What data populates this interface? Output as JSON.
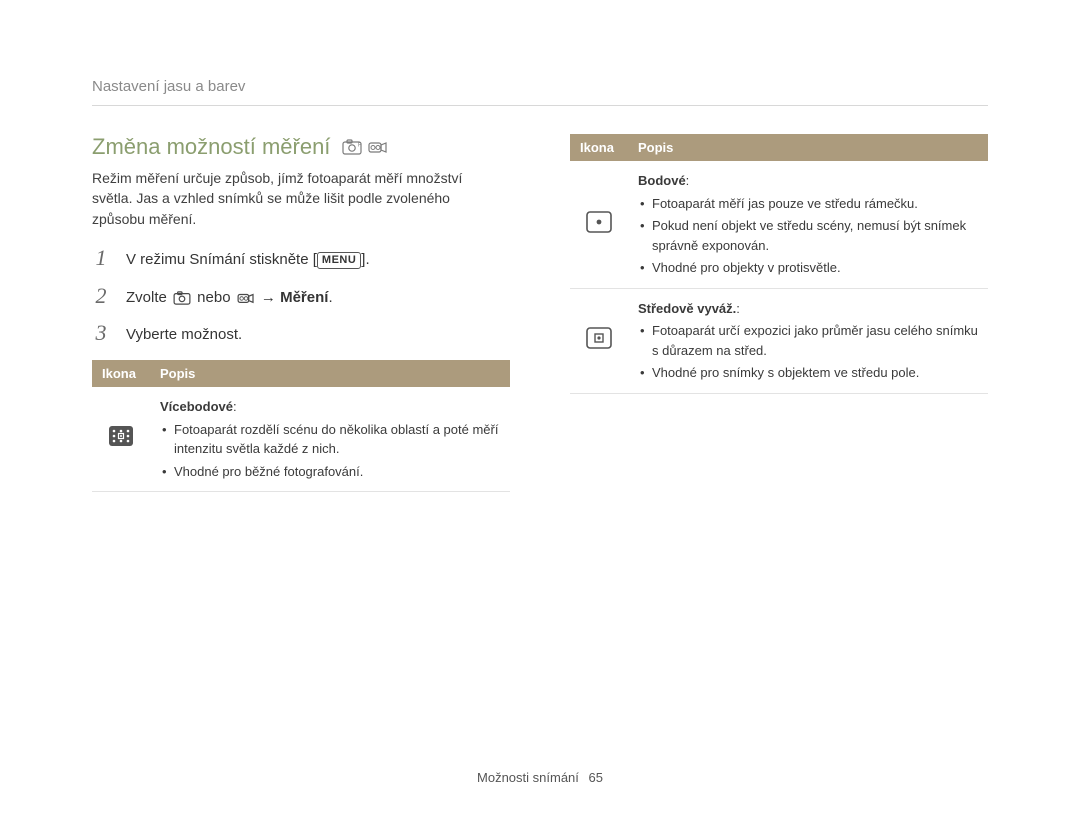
{
  "breadcrumb": "Nastavení jasu a barev",
  "heading": "Změna možností měření",
  "intro": "Režim měření určuje způsob, jímž fotoaparát měří množství světla. Jas a vzhled snímků se může lišit podle zvoleného způsobu měření.",
  "steps": {
    "n1": "1",
    "t1_a": "V režimu Snímání stiskněte [",
    "t1_menu": "MENU",
    "t1_b": "].",
    "n2": "2",
    "t2_a": "Zvolte ",
    "t2_b": " nebo ",
    "t2_c": " → ",
    "t2_bold": "Měření",
    "t2_d": ".",
    "n3": "3",
    "t3": "Vyberte možnost."
  },
  "table": {
    "hdr_icon": "Ikona",
    "hdr_desc": "Popis",
    "rows": [
      {
        "icon": "multi",
        "title": "Vícebodové",
        "items": [
          "Fotoaparát rozdělí scénu do několika oblastí a poté měří intenzitu světla každé z nich.",
          "Vhodné pro běžné fotografování."
        ]
      },
      {
        "icon": "spot",
        "title": "Bodové",
        "items": [
          "Fotoaparát měří jas pouze ve středu rámečku.",
          "Pokud není objekt ve středu scény, nemusí být snímek správně exponován.",
          "Vhodné pro objekty v protisvětle."
        ]
      },
      {
        "icon": "center",
        "title": "Středově vyváž.",
        "items": [
          "Fotoaparát určí expozici jako průměr jasu celého snímku s důrazem na střed.",
          "Vhodné pro snímky s objektem ve středu pole."
        ]
      }
    ]
  },
  "footer": {
    "section": "Možnosti snímání",
    "page": "65"
  }
}
